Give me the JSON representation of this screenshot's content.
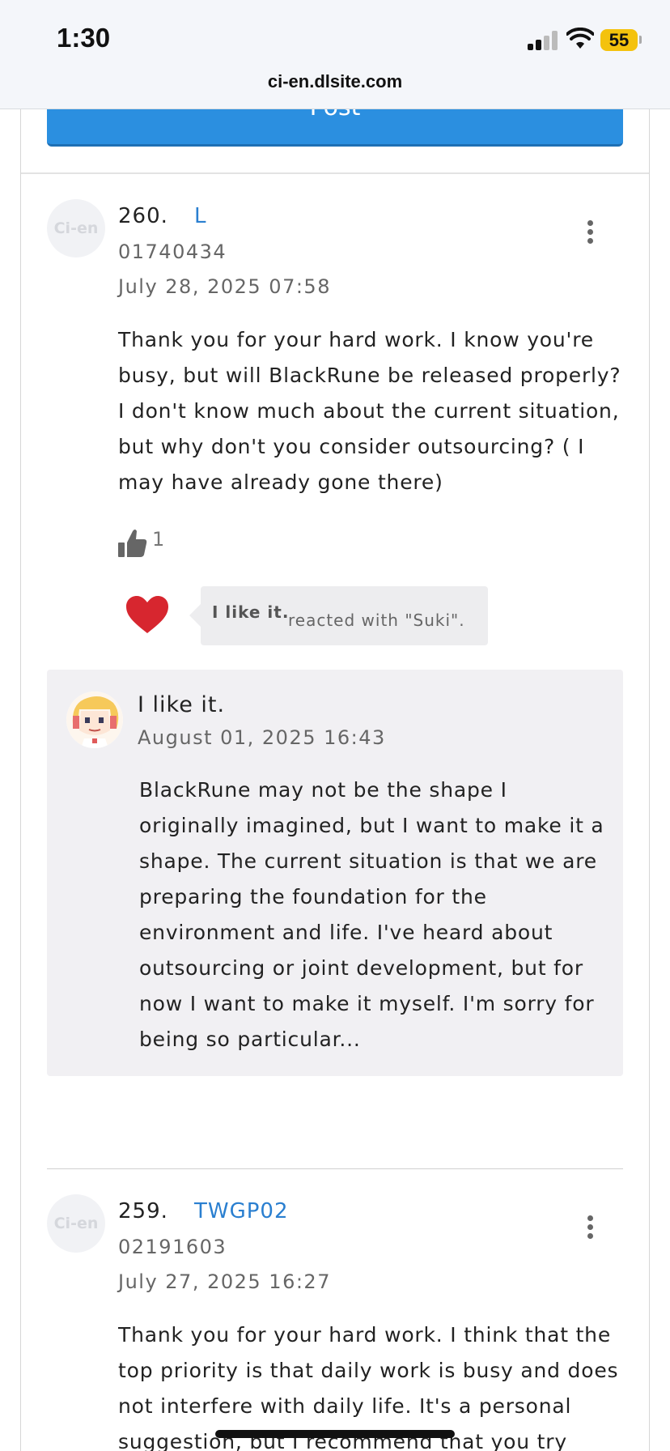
{
  "status_bar": {
    "time": "1:30",
    "battery": "55"
  },
  "browser": {
    "url": "ci-en.dlsite.com"
  },
  "form": {
    "post_label": "Post"
  },
  "comments": [
    {
      "number": "260.",
      "username": "L",
      "user_id": "01740434",
      "date": "July 28, 2025 07:58",
      "avatar_text": "Ci-en",
      "body": "Thank you for your hard work. I know you're busy, but will BlackRune be released properly? I don't know much about the current situation, but why don't you consider outsourcing? ( I may have already gone there)",
      "likes": "1",
      "reaction": {
        "name": "I like it.",
        "text": "reacted with \"Suki\"."
      },
      "reply": {
        "name": "I like it.",
        "date": "August 01, 2025 16:43",
        "body": "BlackRune may not be the shape I originally imagined, but I want to make it a shape. The current situation is that we are preparing the foundation for the environment and life. I've heard about outsourcing or joint development, but for now I want to make it myself. I'm sorry for being so particular..."
      }
    },
    {
      "number": "259.",
      "username": "TWGP02",
      "user_id": "02191603",
      "date": "July 27, 2025 16:27",
      "avatar_text": "Ci-en",
      "body": "Thank you for your hard work. I think that the top priority is that daily work is busy and does not interfere with daily life. It's a personal suggestion, but I recommend that you try"
    }
  ],
  "colors": {
    "accent": "#2b8fe0",
    "username": "#2a7fd0",
    "heart": "#d7262f"
  }
}
